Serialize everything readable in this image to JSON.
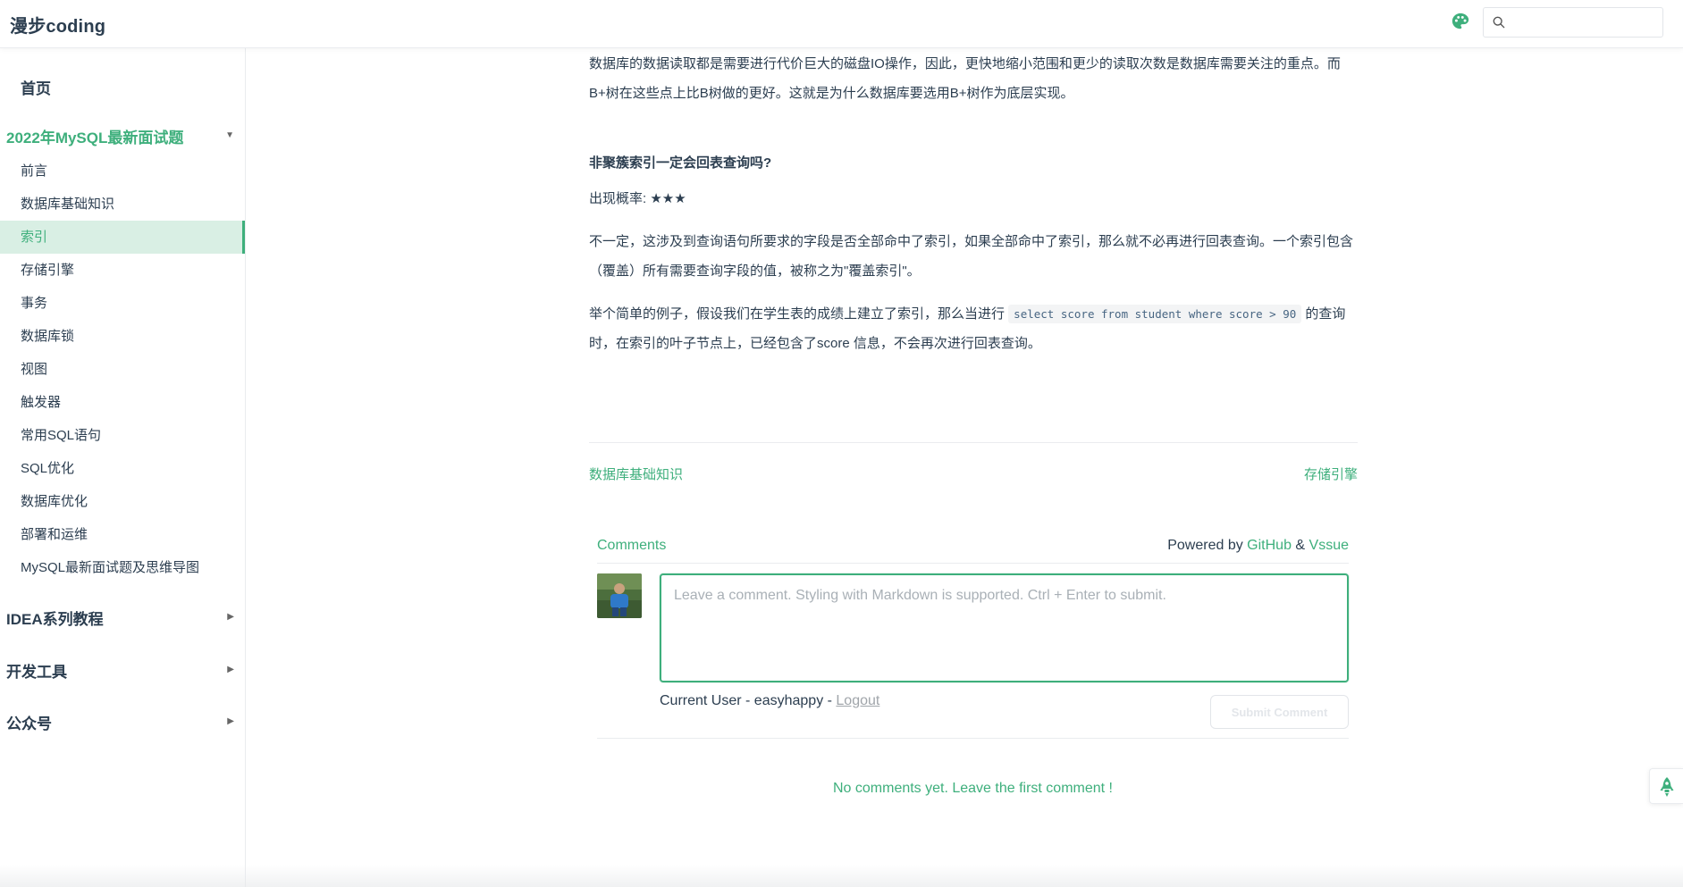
{
  "navbar": {
    "site_title": "漫步coding",
    "search_placeholder": ""
  },
  "sidebar": {
    "home": "首页",
    "groups": [
      {
        "title": "2022年MySQL最新面试题",
        "items": [
          "前言",
          "数据库基础知识",
          "索引",
          "存储引擎",
          "事务",
          "数据库锁",
          "视图",
          "触发器",
          "常用SQL语句",
          "SQL优化",
          "数据库优化",
          "部署和运维",
          "MySQL最新面试题及思维导图"
        ],
        "active_item": "索引"
      },
      {
        "title": "IDEA系列教程"
      },
      {
        "title": "开发工具"
      },
      {
        "title": "公众号"
      }
    ]
  },
  "content": {
    "para1_line1": "数据库的数据读取都是需要进行代价巨大的磁盘IO操作，因此，更快地缩小范围和更少的读取次数是数据库需要关注的重点。而",
    "para1_line2": "B+树在这些点上比B树做的更好。这就是为什么数据库要选用B+树作为底层实现。",
    "heading": "非聚簇索引一定会回表查询吗?",
    "rating_label": "出现概率: ",
    "rating_stars": "★★★",
    "para2_line1": "不一定，这涉及到查询语句所要求的字段是否全部命中了索引，如果全部命中了索引，那么就不必再进行回表查询。一个索引包含",
    "para2_line2": "（覆盖）所有需要查询字段的值，被称之为\"覆盖索引\"。",
    "para3_pre": "举个简单的例子，假设我们在学生表的成绩上建立了索引，那么当进行 ",
    "para3_code": "select score from student where score > 90",
    "para3_post": " 的查询",
    "para3_line2": "时，在索引的叶子节点上，已经包含了score 信息，不会再次进行回表查询。",
    "prev_link": "数据库基础知识",
    "next_link": "存储引擎"
  },
  "comments": {
    "title": "Comments",
    "powered_by": "Powered by ",
    "github": "GitHub",
    "amp": " & ",
    "vssue": "Vssue",
    "textarea_placeholder": "Leave a comment. Styling with Markdown is supported. Ctrl + Enter to submit.",
    "current_user_prefix": "Current User - easyhappy - ",
    "logout": "Logout",
    "submit": "Submit Comment",
    "empty": "No comments yet. Leave the first comment !"
  },
  "colors": {
    "accent": "#3eaf7c",
    "text": "#2c3e50",
    "active_bg": "#d9efe4"
  },
  "icons": {
    "palette": "palette-icon",
    "search": "search-icon",
    "back_to_top": "rocket-icon",
    "expanded": "caret-down-icon",
    "collapsed": "caret-right-icon"
  }
}
